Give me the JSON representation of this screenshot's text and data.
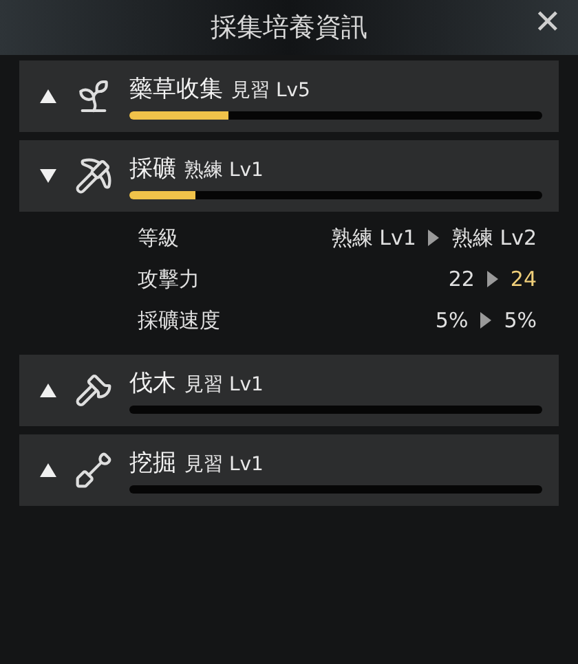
{
  "window": {
    "title": "採集培養資訊",
    "close": "✕"
  },
  "skills": [
    {
      "name": "藥草收集",
      "rank": "見習 Lv5",
      "level": 0.24,
      "expanded": false
    },
    {
      "name": "採礦",
      "rank": "熟練 Lv1",
      "level": 0.16,
      "expanded": true,
      "details": [
        {
          "label": "等級",
          "current": "熟練 Lv1",
          "next": "熟練 Lv2",
          "increased": false
        },
        {
          "label": "攻擊力",
          "current": "22",
          "next": "24",
          "increased": true
        },
        {
          "label": "採礦速度",
          "current": "5%",
          "next": "5%",
          "increased": false
        }
      ]
    },
    {
      "name": "伐木",
      "rank": "見習 Lv1",
      "level": 0,
      "expanded": false
    },
    {
      "name": "挖掘",
      "rank": "見習 Lv1",
      "level": 0,
      "expanded": false
    }
  ]
}
